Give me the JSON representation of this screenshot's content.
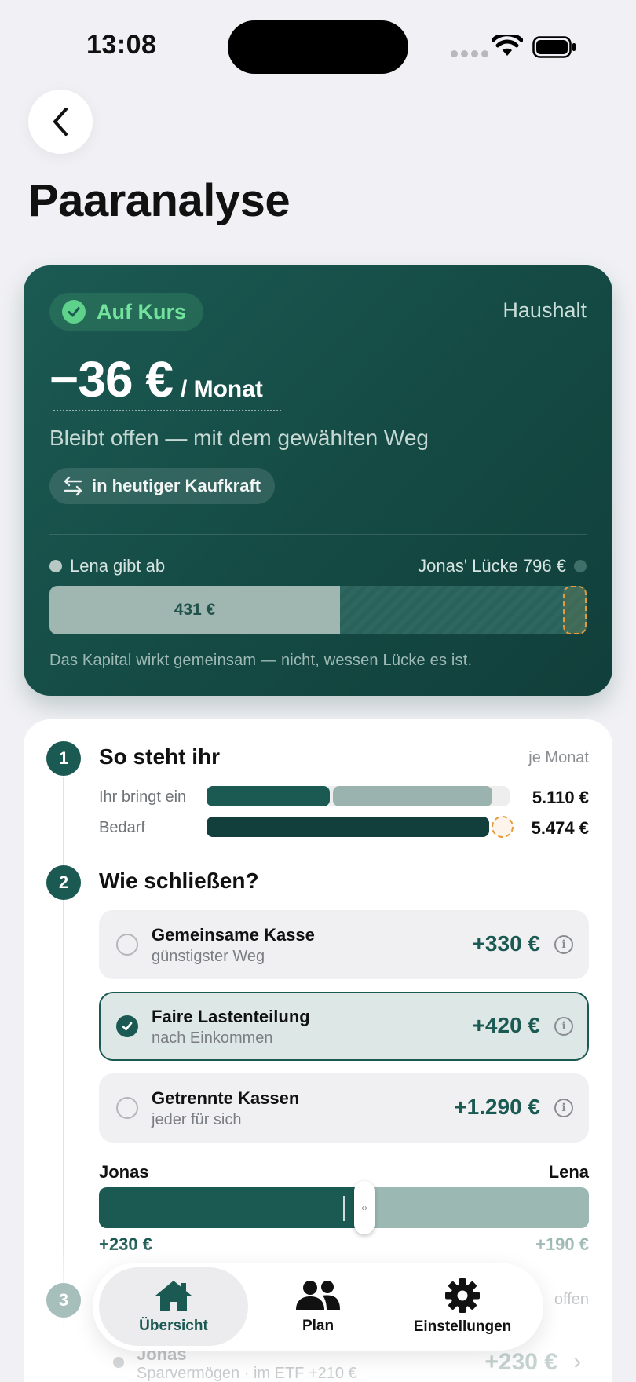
{
  "status": {
    "time": "13:08"
  },
  "page": {
    "title": "Paaranalyse"
  },
  "hero": {
    "status_label": "Auf Kurs",
    "scope": "Haushalt",
    "amount": "−36 €",
    "period": "/ Monat",
    "subtitle": "Bleibt offen — mit dem gewählten Weg",
    "toggle_label": "in heutiger Kaufkraft",
    "legend_left": "Lena gibt ab",
    "legend_right": "Jonas' Lücke 796 €",
    "bar_label": "431 €",
    "bar_fill_fraction": 0.541,
    "note": "Das Kapital wirkt gemeinsam — nicht, wessen Lücke es ist."
  },
  "step1": {
    "number": "1",
    "title": "So steht ihr",
    "per": "je Monat",
    "rows": [
      {
        "label": "Ihr bringt ein",
        "value": "5.110 €"
      },
      {
        "label": "Bedarf",
        "value": "5.474 €"
      }
    ]
  },
  "step2": {
    "number": "2",
    "title": "Wie schließen?",
    "options": [
      {
        "name": "Gemeinsame Kasse",
        "sub": "günstigster Weg",
        "value": "+330 €",
        "selected": false
      },
      {
        "name": "Faire Lastenteilung",
        "sub": "nach Einkommen",
        "value": "+420 €",
        "selected": true
      },
      {
        "name": "Getrennte Kassen",
        "sub": "jeder für sich",
        "value": "+1.290 €",
        "selected": false
      }
    ],
    "split": {
      "left_name": "Jonas",
      "right_name": "Lena",
      "left_value": "+230 €",
      "right_value": "+190 €",
      "left_fraction": 0.548
    }
  },
  "step3": {
    "number": "3",
    "right_text": "offen",
    "row_name": "Jonas",
    "row_sub": "Sparvermögen · im ETF +210 €",
    "row_value": "+230 €"
  },
  "tabs": [
    {
      "label": "Übersicht",
      "icon": "home-icon",
      "active": true
    },
    {
      "label": "Plan",
      "icon": "people-icon",
      "active": false
    },
    {
      "label": "Einstellungen",
      "icon": "gear-icon",
      "active": false
    }
  ],
  "colors": {
    "primary": "#1b5a53",
    "accent_green": "#72e29c",
    "gap_orange": "#e79a3b",
    "secondary_bar": "#9bb8b2"
  }
}
